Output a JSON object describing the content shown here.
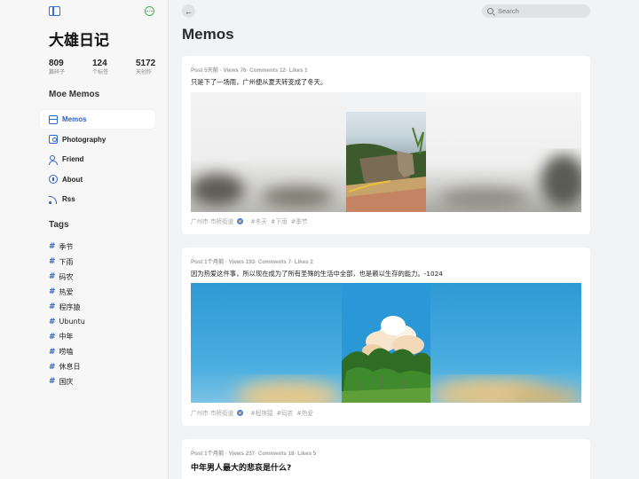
{
  "sidebar": {
    "site_title": "大雄日记",
    "stats": [
      {
        "value": "809",
        "label": "篇碎子"
      },
      {
        "value": "124",
        "label": "个标签"
      },
      {
        "value": "5172",
        "label": "天创作"
      }
    ],
    "app_name": "Moe Memos",
    "nav": [
      {
        "label": "Memos",
        "icon": "memos-icon",
        "active": true
      },
      {
        "label": "Photography",
        "icon": "photography-icon"
      },
      {
        "label": "Friend",
        "icon": "friend-icon"
      },
      {
        "label": "About",
        "icon": "about-icon"
      },
      {
        "label": "Rss",
        "icon": "rss-icon"
      }
    ],
    "tags_title": "Tags",
    "tags": [
      "季节",
      "下雨",
      "码农",
      "热爱",
      "程序猿",
      "Ubuntu",
      "中年",
      "唠嗑",
      "休息日",
      "国庆"
    ]
  },
  "header": {
    "search_placeholder": "Search",
    "page_title": "Memos"
  },
  "posts": [
    {
      "meta": "Post 5天前 · Views 76· Comments 12· Likes 1",
      "text": "只是下了一场雨，广州便从夏天转变成了冬天。",
      "location": "广州市·市桥街道",
      "tags": [
        "#冬天",
        "#下雨",
        "#季节"
      ]
    },
    {
      "meta": "Post 1个月前 · Views 193· Comments 7· Likes 2",
      "text": "因为热爱这件事，所以现在成为了所有圣殊的生活中全部，也是赖以生存的能力。-1024",
      "location": "广州市·市桥街道",
      "tags": [
        "#程序猿",
        "#码农",
        "#热爱"
      ]
    },
    {
      "meta": "Post 1个月前 · Views 237· Comments 18· Likes 5",
      "heading": "中年男人最大的悲哀是什么?"
    }
  ],
  "colors": {
    "accent": "#2e63c9",
    "background": "#f2f3f5"
  }
}
